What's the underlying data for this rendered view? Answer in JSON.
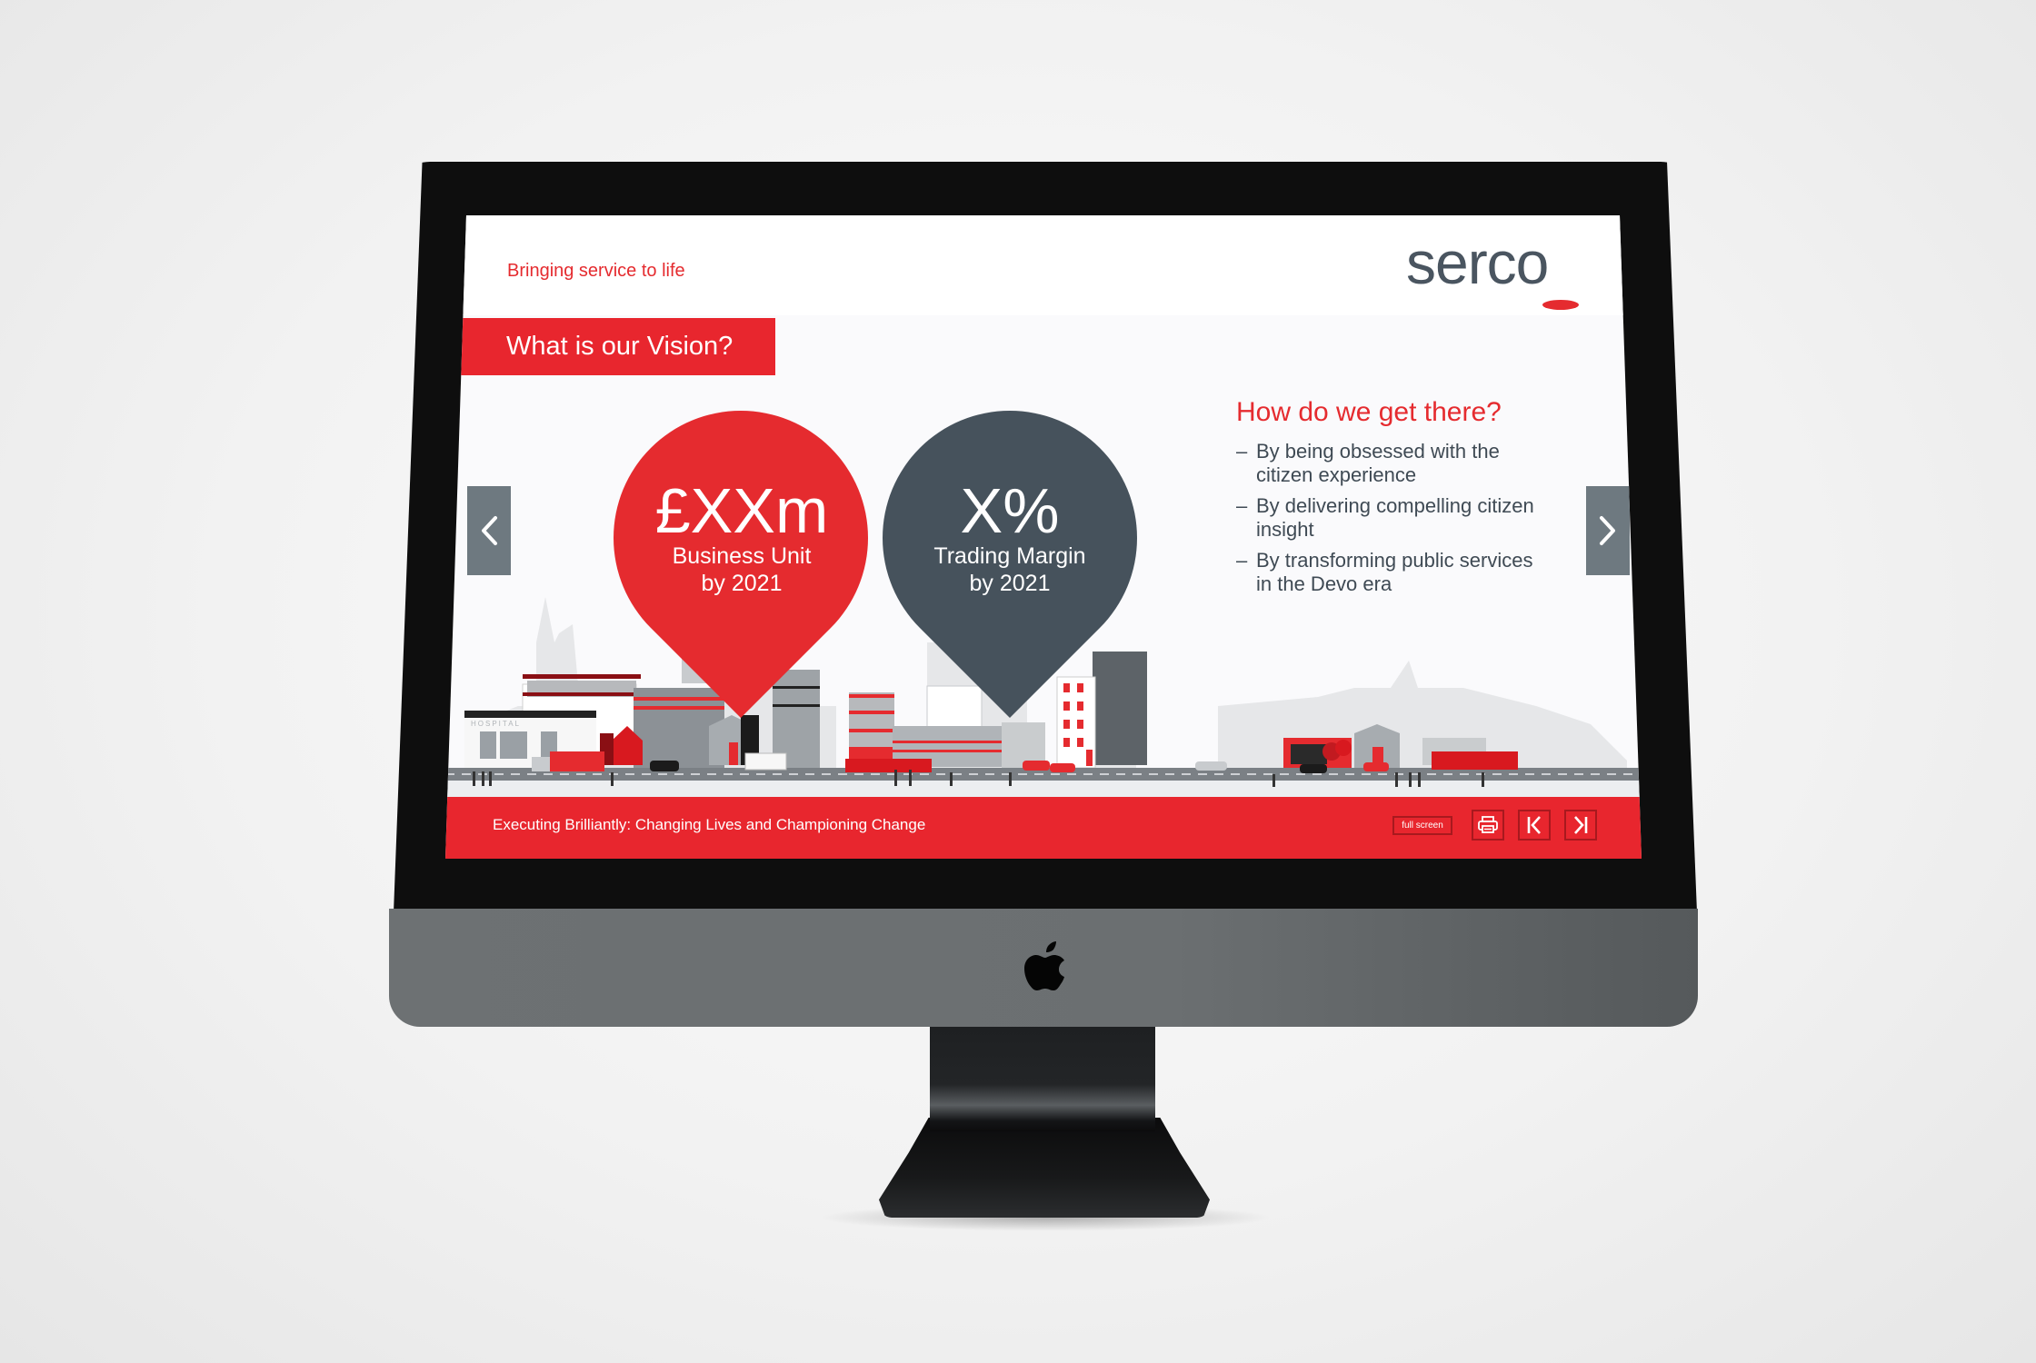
{
  "presentation": {
    "tagline": "Bringing service to life",
    "logo_text": "serco",
    "brand_colors": {
      "red": "#e8262e",
      "dark_grey": "#46525c",
      "nav_grey": "#6e7980"
    },
    "slide_title": "What is our Vision?",
    "pins": [
      {
        "value": "£XXm",
        "label_line1": "Business Unit",
        "label_line2": "by 2021",
        "color": "red"
      },
      {
        "value": "X%",
        "label_line1": "Trading Margin",
        "label_line2": "by 2021",
        "color": "dark_grey"
      }
    ],
    "how": {
      "title": "How do we get there?",
      "items": [
        "By being obsessed with the citizen experience",
        "By delivering compelling citizen insight",
        "By transforming public services in the Devo era"
      ],
      "bullet": "–"
    },
    "illustration": {
      "hospital_sign": "HOSPITAL"
    },
    "nav": {
      "prev_icon": "chevron-left-icon",
      "next_icon": "chevron-right-icon"
    },
    "footer": {
      "text": "Executing Brilliantly: Changing Lives and Championing Change",
      "full_screen_label": "full screen",
      "print_icon": "printer-icon",
      "first_icon": "skip-to-first-icon",
      "last_icon": "skip-to-last-icon"
    }
  }
}
